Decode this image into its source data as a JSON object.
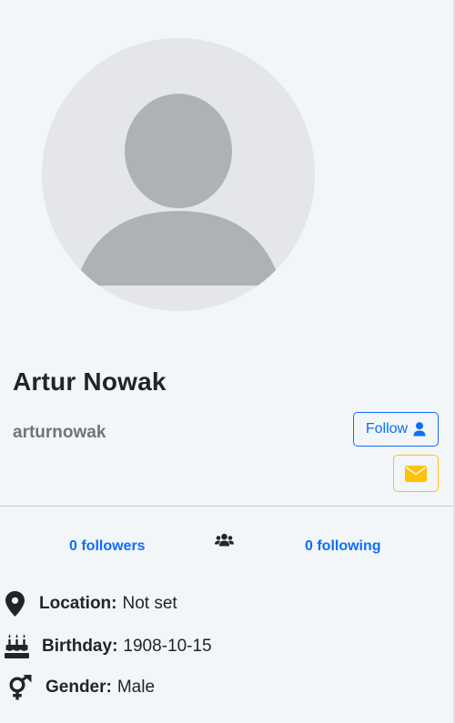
{
  "profile": {
    "name": "Artur Nowak",
    "username": "arturnowak"
  },
  "actions": {
    "follow_label": "Follow",
    "follow_icon": "user-icon",
    "message_icon": "envelope-icon"
  },
  "stats": {
    "followers": "0 followers",
    "following": "0 following",
    "icon": "users-icon"
  },
  "info": [
    {
      "icon": "map-marker-icon",
      "label": "Location:",
      "value": "Not set"
    },
    {
      "icon": "birthday-cake-icon",
      "label": "Birthday:",
      "value": "1908-10-15"
    },
    {
      "icon": "venus-mars-icon",
      "label": "Gender:",
      "value": "Male"
    }
  ],
  "colors": {
    "background": "#f3f6f9",
    "primary": "#0d6efd",
    "warning": "#ffc107",
    "muted": "#6c757d",
    "avatar_bg": "#e4e6e9",
    "avatar_fg": "#adb2b6"
  }
}
